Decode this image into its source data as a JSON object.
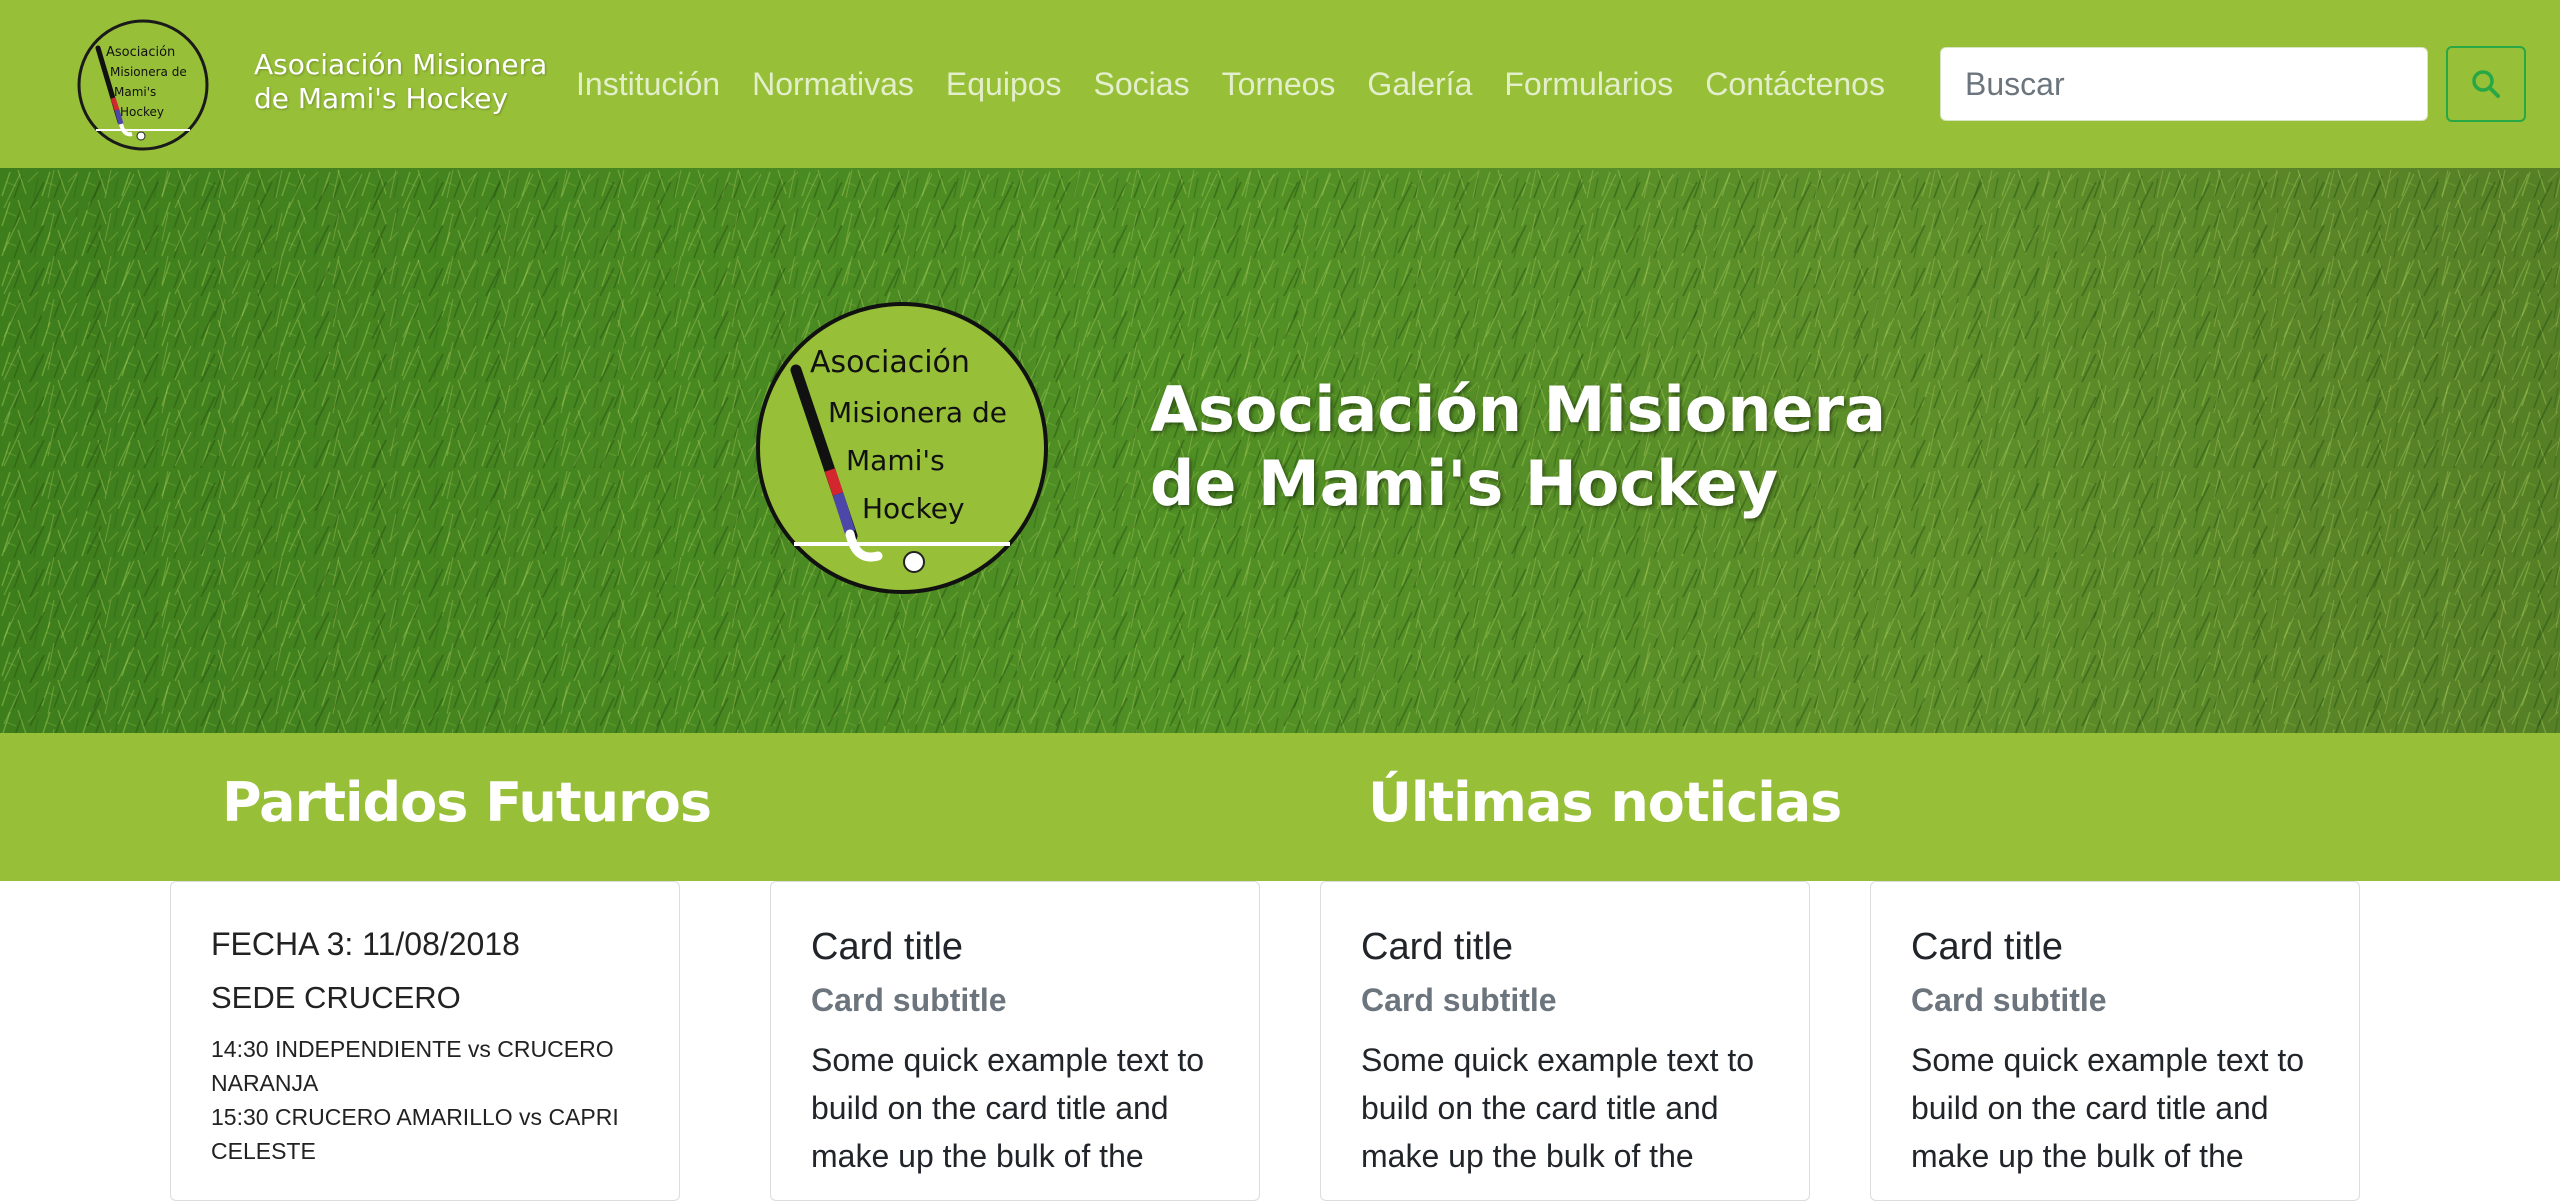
{
  "brand": {
    "line1": "Asociación Misionera",
    "line2": "de Mami's Hockey",
    "logo_text": [
      "Asociación",
      "Misionera de",
      "Mami's",
      "Hockey"
    ],
    "colors": {
      "primary": "#97bf37",
      "search_accent": "#28a745"
    }
  },
  "nav": {
    "items": [
      {
        "label": "Institución"
      },
      {
        "label": "Normativas"
      },
      {
        "label": "Equipos"
      },
      {
        "label": "Socias"
      },
      {
        "label": "Torneos"
      },
      {
        "label": "Galería"
      },
      {
        "label": "Formularios"
      },
      {
        "label": "Contáctenos"
      }
    ],
    "search": {
      "placeholder": "Buscar",
      "icon": "search-icon"
    }
  },
  "hero": {
    "title_line1": "Asociación Misionera",
    "title_line2": "de Mami's Hockey"
  },
  "sections": {
    "left_title": "Partidos Futuros",
    "right_title": "Últimas noticias"
  },
  "matches": {
    "date": "FECHA 3: 11/08/2018",
    "venue": "SEDE CRUCERO",
    "lines": [
      "14:30 INDEPENDIENTE vs CRUCERO",
      "NARANJA",
      "15:30 CRUCERO AMARILLO vs CAPRI",
      "CELESTE"
    ]
  },
  "news": [
    {
      "title": "Card title",
      "subtitle": "Card subtitle",
      "text": [
        "Some quick example text to",
        "build on the card title and",
        "make up the bulk of the"
      ]
    },
    {
      "title": "Card title",
      "subtitle": "Card subtitle",
      "text": [
        "Some quick example text to",
        "build on the card title and",
        "make up the bulk of the"
      ]
    },
    {
      "title": "Card title",
      "subtitle": "Card subtitle",
      "text": [
        "Some quick example text to",
        "build on the card title and",
        "make up the bulk of the"
      ]
    }
  ]
}
